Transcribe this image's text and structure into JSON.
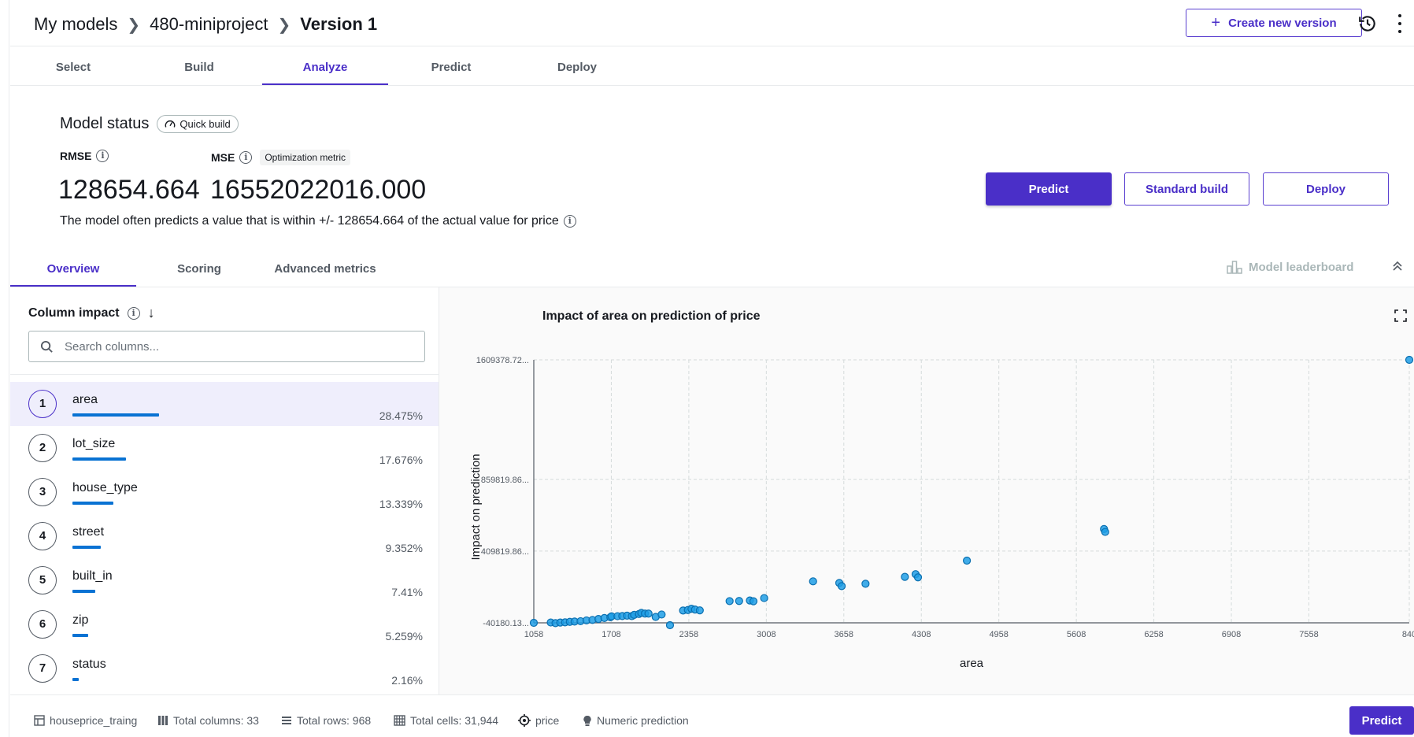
{
  "breadcrumb": {
    "root": "My models",
    "project": "480-miniproject",
    "current": "Version 1"
  },
  "header": {
    "create_label": "Create new version"
  },
  "main_tabs": [
    {
      "label": "Select"
    },
    {
      "label": "Build"
    },
    {
      "label": "Analyze",
      "active": true
    },
    {
      "label": "Predict"
    },
    {
      "label": "Deploy"
    }
  ],
  "model_status": {
    "title": "Model status",
    "badge": "Quick build",
    "rmse_label": "RMSE",
    "rmse_value": "128654.664",
    "mse_label": "MSE",
    "mse_badge": "Optimization metric",
    "mse_value": "16552022016.000",
    "description": "The model often predicts a value that is within +/- 128654.664 of the actual value for price"
  },
  "actions": {
    "predict": "Predict",
    "standard_build": "Standard build",
    "deploy": "Deploy"
  },
  "sub_tabs": [
    {
      "label": "Overview",
      "active": true
    },
    {
      "label": "Scoring"
    },
    {
      "label": "Advanced metrics"
    }
  ],
  "leaderboard_label": "Model leaderboard",
  "column_impact": {
    "title": "Column impact",
    "search_placeholder": "Search columns...",
    "columns": [
      {
        "rank": "1",
        "name": "area",
        "pct": "28.475%",
        "value": 28.475
      },
      {
        "rank": "2",
        "name": "lot_size",
        "pct": "17.676%",
        "value": 17.676
      },
      {
        "rank": "3",
        "name": "house_type",
        "pct": "13.339%",
        "value": 13.339
      },
      {
        "rank": "4",
        "name": "street",
        "pct": "9.352%",
        "value": 9.352
      },
      {
        "rank": "5",
        "name": "built_in",
        "pct": "7.41%",
        "value": 7.41
      },
      {
        "rank": "6",
        "name": "zip",
        "pct": "5.259%",
        "value": 5.259
      },
      {
        "rank": "7",
        "name": "status",
        "pct": "2.16%",
        "value": 2.16
      }
    ]
  },
  "chart_data": {
    "type": "scatter",
    "title": "Impact of area on prediction of price",
    "xlabel": "area",
    "ylabel": "Impact on prediction",
    "xlim": [
      1058,
      8400
    ],
    "ylim": [
      -40180.13,
      1609378.72
    ],
    "x_ticks": [
      "1058",
      "1708",
      "2358",
      "3008",
      "3658",
      "4308",
      "4958",
      "5608",
      "6258",
      "6908",
      "7558",
      "840"
    ],
    "y_ticks": [
      {
        "label": "1609378.72...",
        "value": 1609378.72
      },
      {
        "label": "859819.86...",
        "value": 859819.86
      },
      {
        "label": "409819.86...",
        "value": 409819.86
      },
      {
        "label": "-40180.13...",
        "value": -40180.13
      }
    ],
    "grid": true,
    "points": [
      [
        1058,
        -40180
      ],
      [
        1200,
        -38000
      ],
      [
        1240,
        -42000
      ],
      [
        1280,
        -38500
      ],
      [
        1320,
        -37000
      ],
      [
        1360,
        -34000
      ],
      [
        1400,
        -32000
      ],
      [
        1450,
        -30000
      ],
      [
        1500,
        -25000
      ],
      [
        1550,
        -22000
      ],
      [
        1600,
        -16000
      ],
      [
        1650,
        -10000
      ],
      [
        1700,
        -5000
      ],
      [
        1710,
        500
      ],
      [
        1760,
        1500
      ],
      [
        1800,
        2500
      ],
      [
        1840,
        5000
      ],
      [
        1880,
        2000
      ],
      [
        1900,
        10000
      ],
      [
        1940,
        15000
      ],
      [
        1960,
        22000
      ],
      [
        1990,
        18000
      ],
      [
        2020,
        18000
      ],
      [
        2080,
        -3000
      ],
      [
        2130,
        12000
      ],
      [
        2200,
        -55000
      ],
      [
        2310,
        37000
      ],
      [
        2350,
        40000
      ],
      [
        2380,
        48000
      ],
      [
        2410,
        43000
      ],
      [
        2450,
        38000
      ],
      [
        2700,
        96000
      ],
      [
        2780,
        97000
      ],
      [
        2870,
        100000
      ],
      [
        2900,
        95000
      ],
      [
        2990,
        115000
      ],
      [
        3400,
        220000
      ],
      [
        3620,
        210000
      ],
      [
        3640,
        190000
      ],
      [
        3840,
        205000
      ],
      [
        4170,
        248000
      ],
      [
        4260,
        265000
      ],
      [
        4280,
        245000
      ],
      [
        4690,
        350000
      ],
      [
        5840,
        548000
      ],
      [
        5850,
        530000
      ],
      [
        8400,
        1609378
      ]
    ]
  },
  "footer": {
    "dataset": "houseprice_traing",
    "total_columns": "Total columns: 33",
    "total_rows": "Total rows: 968",
    "total_cells": "Total cells: 31,944",
    "target": "price",
    "problem_type": "Numeric prediction",
    "predict_label": "Predict"
  },
  "colors": {
    "accent": "#4a2fc8",
    "bar": "#0972d3",
    "point": "#1f9de5"
  }
}
